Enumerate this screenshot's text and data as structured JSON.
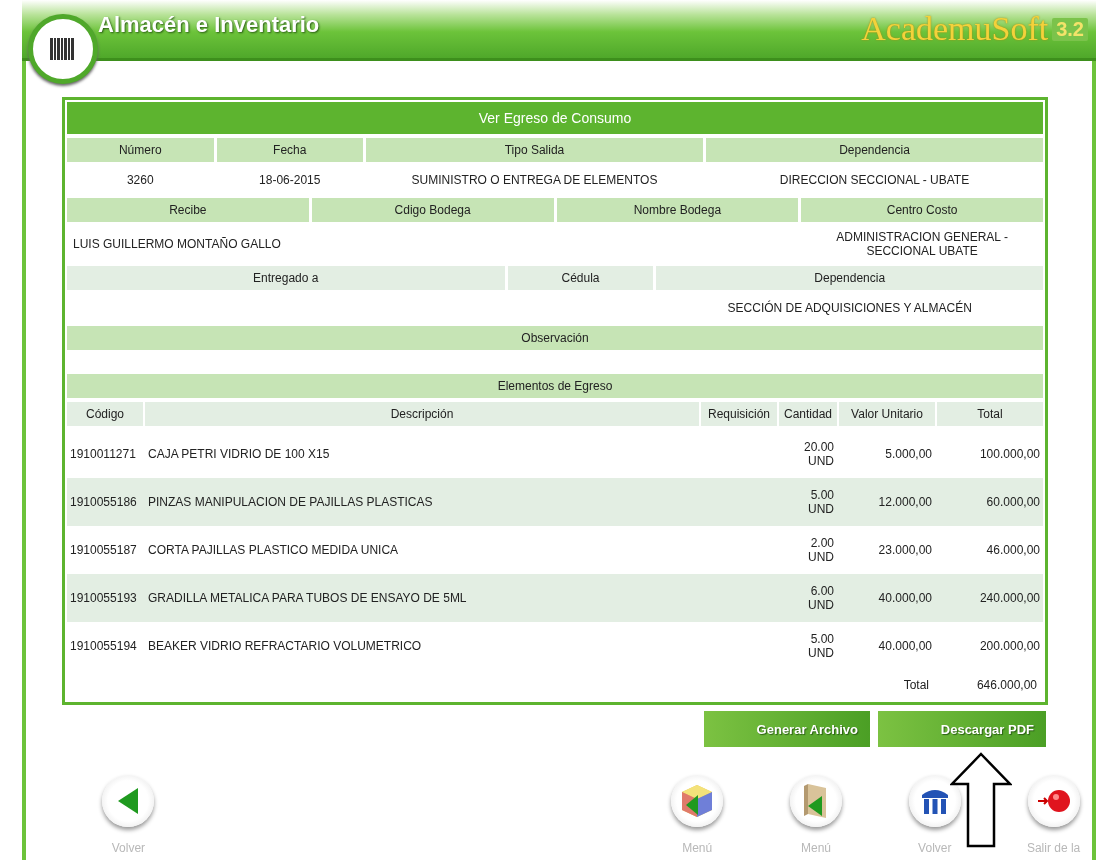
{
  "header": {
    "title": "Almacén e Inventario",
    "brand": "AcademuSoft",
    "version": "3.2"
  },
  "panel": {
    "title": "Ver Egreso de Consumo",
    "info_blocks": [
      {
        "cells": [
          {
            "label": "Número",
            "value": "3260"
          },
          {
            "label": "Fecha",
            "value": "18-06-2015"
          },
          {
            "label": "Tipo Salida",
            "value": "SUMINISTRO O ENTREGA DE ELEMENTOS"
          },
          {
            "label": "Dependencia",
            "value": "DIRECCION SECCIONAL - UBATE"
          }
        ]
      },
      {
        "cells": [
          {
            "label": "Recibe",
            "value": "LUIS GUILLERMO MONTAÑO GALLO"
          },
          {
            "label": "Cdigo Bodega"
          },
          {
            "label": "Nombre Bodega"
          },
          {
            "label": "Centro Costo",
            "value": "ADMINISTRACION GENERAL - SECCIONAL UBATE"
          }
        ]
      },
      {
        "cells": [
          {
            "label": "Entregado a"
          },
          {
            "label": "Cédula"
          },
          {
            "label": "Dependencia",
            "value": "SECCIÓN DE ADQUISICIONES Y ALMACÉN"
          }
        ]
      },
      {
        "cells": [
          {
            "label": "Observación"
          }
        ]
      }
    ],
    "items": {
      "title": "Elementos de Egreso",
      "columns": [
        "Código",
        "Descripción",
        "Requisición",
        "Cantidad",
        "Valor Unitario",
        "Total"
      ],
      "rows": [
        {
          "code": "1910011271",
          "description": "CAJA PETRI VIDRIO DE 100 X15",
          "quantity": "20.00\nUND",
          "unit_value": "5.000,00",
          "total": "100.000,00"
        },
        {
          "code": "1910055186",
          "description": "PINZAS MANIPULACION DE PAJILLAS PLASTICAS",
          "quantity": "5.00\nUND",
          "unit_value": "12.000,00",
          "total": "60.000,00"
        },
        {
          "code": "1910055187",
          "description": "CORTA PAJILLAS PLASTICO MEDIDA UNICA",
          "quantity": "2.00\nUND",
          "unit_value": "23.000,00",
          "total": "46.000,00"
        },
        {
          "code": "1910055193",
          "description": "GRADILLA METALICA PARA TUBOS DE ENSAYO DE 5ML",
          "quantity": "6.00\nUND",
          "unit_value": "40.000,00",
          "total": "240.000,00"
        },
        {
          "code": "1910055194",
          "description": "BEAKER VIDRIO REFRACTARIO VOLUMETRICO",
          "quantity": "5.00\nUND",
          "unit_value": "40.000,00",
          "total": "200.000,00"
        }
      ],
      "total_label": "Total",
      "grand_total": "646.000,00"
    }
  },
  "actions": [
    "Generar Archivo",
    "Descargar PDF"
  ],
  "nav": [
    {
      "kind": "back",
      "label": "Volver"
    },
    {
      "kind": "cube",
      "label": "Menú"
    },
    {
      "kind": "book",
      "label": "Menú"
    },
    {
      "kind": "columns",
      "label": "Volver"
    },
    {
      "kind": "exit",
      "label": "Salir de la"
    }
  ]
}
